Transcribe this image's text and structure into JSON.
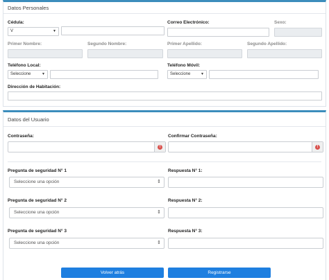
{
  "personal": {
    "title": "Datos Personales",
    "cedula_label": "Cédula:",
    "cedula_type": "V",
    "correo_label": "Correo Electrónico:",
    "sexo_label": "Sexo:",
    "primer_nombre_label": "Primer Nombre:",
    "segundo_nombre_label": "Segundo Nombre:",
    "primer_apellido_label": "Primer Apellido:",
    "segundo_apellido_label": "Segundo Apellido:",
    "tel_local_label": "Teléfono Local:",
    "tel_local_select": "Seleccione",
    "tel_movil_label": "Teléfono Móvil:",
    "tel_movil_select": "Seleccione",
    "direccion_label": "Dirección de Habitación:"
  },
  "usuario": {
    "title": "Datos del Usuario",
    "password_label": "Contraseña:",
    "confirm_label": "Confirmar Contraseña:",
    "error_symbol": "!",
    "questions": [
      {
        "label": "Pregunta de seguridad N° 1",
        "placeholder": "Seleccione una opción",
        "answer_label": "Respuesta N° 1:"
      },
      {
        "label": "Pregunta de seguridad N° 2",
        "placeholder": "Seleccione una opción",
        "answer_label": "Respuesta N° 2:"
      },
      {
        "label": "Pregunta de seguridad N° 3",
        "placeholder": "Seleccione una opción",
        "answer_label": "Respuesta N° 3:"
      }
    ]
  },
  "actions": {
    "back_label": "Volver atrás",
    "register_label": "Registrarse"
  },
  "colors": {
    "accent": "#3c8dbc",
    "button": "#1e7fe0",
    "error": "#d9534f"
  }
}
